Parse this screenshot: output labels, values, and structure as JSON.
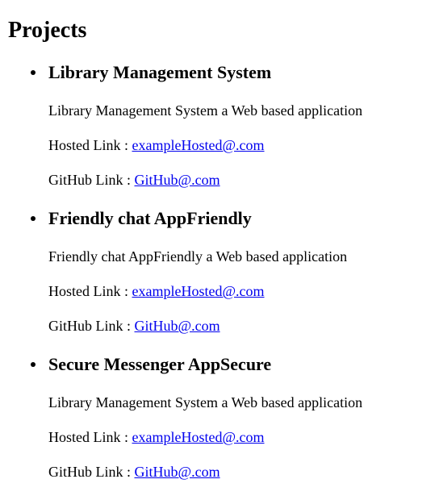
{
  "section": {
    "title": "Projects"
  },
  "projects": [
    {
      "name": "Library Management System",
      "description": "Library Management System a Web based application",
      "hosted_label": "Hosted Link : ",
      "hosted_link": "exampleHosted@.com",
      "github_label": "GitHub Link : ",
      "github_link": "GitHub@.com"
    },
    {
      "name": "Friendly chat AppFriendly",
      "description": "Friendly chat AppFriendly a Web based application",
      "hosted_label": "Hosted Link : ",
      "hosted_link": "exampleHosted@.com",
      "github_label": "GitHub Link : ",
      "github_link": "GitHub@.com"
    },
    {
      "name": "Secure Messenger AppSecure",
      "description": "Library Management System a Web based application",
      "hosted_label": "Hosted Link : ",
      "hosted_link": "exampleHosted@.com",
      "github_label": "GitHub Link : ",
      "github_link": "GitHub@.com"
    }
  ],
  "colors": {
    "link": "#0000ee",
    "text": "#000000",
    "background": "#ffffff"
  }
}
